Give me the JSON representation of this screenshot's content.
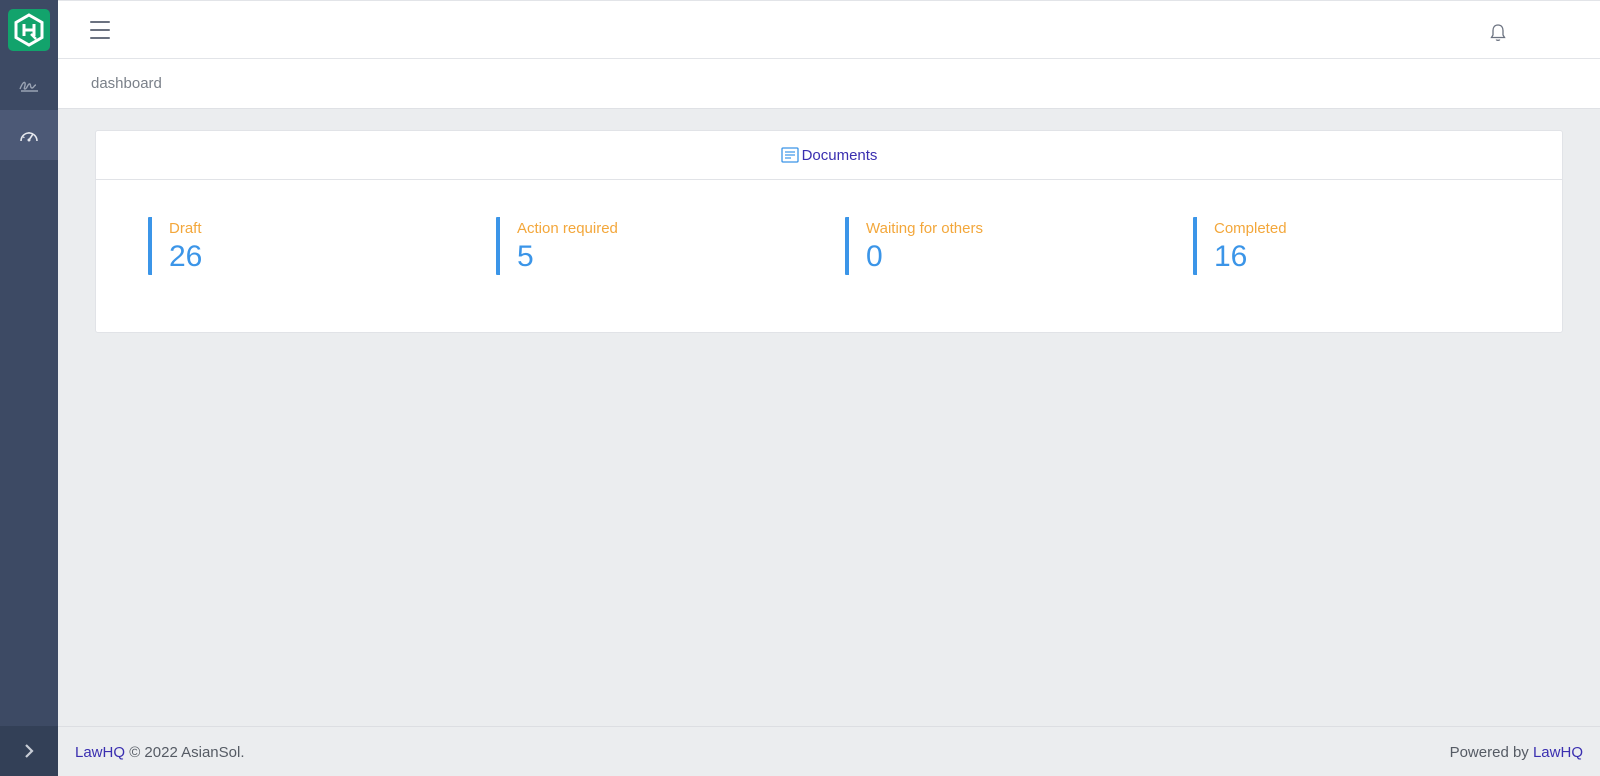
{
  "sidebar": {
    "logo": "lawhq-logo",
    "items": [
      {
        "icon": "signature-icon",
        "active": false
      },
      {
        "icon": "speedometer-icon",
        "active": true
      }
    ],
    "toggle_icon": "chevron-right-icon"
  },
  "header": {
    "menu_icon": "hamburger-icon",
    "notification_icon": "bell-icon"
  },
  "breadcrumb": {
    "current": "dashboard"
  },
  "documents": {
    "title": "Documents",
    "icon": "document-icon",
    "stats": [
      {
        "label": "Draft",
        "value": "26"
      },
      {
        "label": "Action required",
        "value": "5"
      },
      {
        "label": "Waiting for others",
        "value": "0"
      },
      {
        "label": "Completed",
        "value": "16"
      }
    ]
  },
  "footer": {
    "brand_link": "LawHQ",
    "copyright": "© 2022 AsianSol.",
    "powered_by": "Powered by",
    "powered_link": "LawHQ"
  },
  "colors": {
    "sidebar": "#3d4a64",
    "brand": "#12a36c",
    "accent_blue": "#3b95e8",
    "label_orange": "#f3a73b",
    "link_purple": "#3a2fb0"
  }
}
